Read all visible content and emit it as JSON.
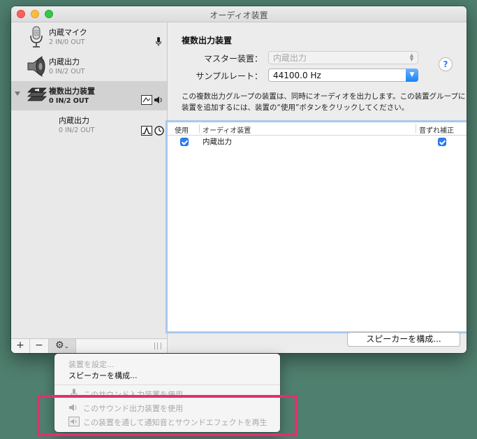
{
  "window": {
    "title": "オーディオ装置"
  },
  "devices": [
    {
      "name": "内蔵マイク",
      "io": "2 IN/0 OUT",
      "icon": "microphone-icon",
      "badge": "microphone-badge-icon"
    },
    {
      "name": "内蔵出力",
      "io": "0 IN/2 OUT",
      "icon": "speaker-icon"
    },
    {
      "name": "複数出力装置",
      "io": "0 IN/2 OUT",
      "icon": "multi-output-icon",
      "selected": true
    },
    {
      "name": "内蔵出力",
      "io": "0 IN/2 OUT",
      "sub": true
    }
  ],
  "toolbar": {
    "plus": "+",
    "minus": "−",
    "gear": "⚙",
    "gear_caret": "⌄"
  },
  "panel": {
    "title": "複数出力装置",
    "master_label": "マスター装置：",
    "master_value": "内蔵出力",
    "rate_label": "サンプルレート：",
    "rate_value": "44100.0 Hz",
    "help": "?",
    "description": "この複数出力グループの装置は、同時にオーディオを出力します。この装置グループに装置を追加するには、装置の“使用”ボタンをクリックしてください。",
    "table": {
      "headers": {
        "use": "使用",
        "device": "オーディオ装置",
        "drift": "音ずれ補正"
      },
      "rows": [
        {
          "use": true,
          "device": "内蔵出力",
          "drift": true
        }
      ]
    },
    "configure_button": "スピーカーを構成..."
  },
  "menu": {
    "items": [
      {
        "label": "装置を設定...",
        "disabled": true
      },
      {
        "label": "スピーカーを構成...",
        "disabled": false
      },
      {
        "label": "このサウンド入力装置を使用",
        "disabled": true,
        "icon": "microphone-icon"
      },
      {
        "label": "このサウンド出力装置を使用",
        "disabled": true,
        "icon": "speaker-icon"
      },
      {
        "label": "この装置を通して通知音とサウンドエフェクトを再生",
        "disabled": true,
        "icon": "alert-speaker-icon"
      }
    ]
  },
  "colors": {
    "accent": "#2f7ef6",
    "highlight": "#e0306f",
    "desktop": "#4f7f6e"
  }
}
